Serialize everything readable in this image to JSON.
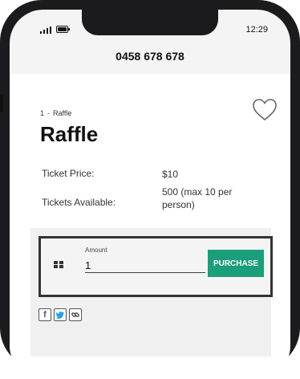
{
  "status_bar": {
    "time": "12:29",
    "icons": [
      "signal-icon",
      "battery-icon"
    ]
  },
  "header": {
    "phone": "0458 678 678"
  },
  "breadcrumb": {
    "number": "1",
    "separator": "-",
    "current": "Raffle"
  },
  "page": {
    "title": "Raffle",
    "favorite_icon": "heart-outline-icon"
  },
  "details": {
    "ticket_price_label": "Ticket Price:",
    "ticket_price_value": "$10",
    "tickets_available_label": "Tickets Available:",
    "tickets_available_value_line1": "500 (max 10 per",
    "tickets_available_value_line2": "person)"
  },
  "form": {
    "amount_label": "Amount",
    "amount_value": "1",
    "purchase_label": "PURCHASE",
    "accent_color": "#1b9e7a"
  },
  "share": {
    "icons": [
      "facebook-icon",
      "twitter-icon",
      "link-icon"
    ]
  }
}
